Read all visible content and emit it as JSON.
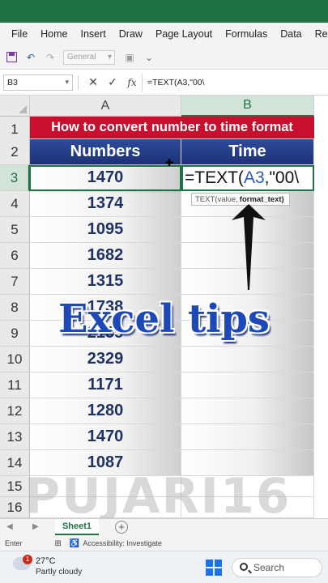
{
  "ribbon": {
    "tabs": [
      "File",
      "Home",
      "Insert",
      "Draw",
      "Page Layout",
      "Formulas",
      "Data",
      "Revi"
    ]
  },
  "toolbar": {
    "number_format": "General"
  },
  "formula_bar": {
    "name_box": "B3",
    "cancel": "✕",
    "enter": "✓",
    "fx": "fx",
    "formula": "=TEXT(A3,\"00\\"
  },
  "columns": [
    "A",
    "B"
  ],
  "rows": [
    "1",
    "2",
    "3",
    "4",
    "5",
    "6",
    "7",
    "8",
    "9",
    "10",
    "11",
    "12",
    "13",
    "14",
    "15",
    "16"
  ],
  "sheet": {
    "title": "How to convert number to time format",
    "header_numbers": "Numbers",
    "header_time": "Time",
    "numbers": [
      "1470",
      "1374",
      "1095",
      "1682",
      "1315",
      "1738",
      "2155",
      "2329",
      "1171",
      "1280",
      "1470",
      "1087"
    ],
    "editing_prefix": "=TEXT(",
    "editing_ref": "A3",
    "editing_suffix": ",\"00\\",
    "tooltip_fn": "TEXT(value,",
    "tooltip_arg": "format_text)"
  },
  "overlay_text": "Excel tips",
  "watermark": "PUJARI16",
  "sheet_tabs": {
    "active": "Sheet1",
    "add": "+"
  },
  "status": {
    "mode": "Enter",
    "accessibility": "Accessibility: Investigate"
  },
  "taskbar": {
    "temperature": "27°C",
    "condition": "Partly cloudy",
    "notification_count": "1",
    "search_placeholder": "Search"
  },
  "colors": {
    "excel_green": "#1f7246",
    "title_red": "#c8102e",
    "header_blue": "#1c3177",
    "number_text": "#1f3264"
  }
}
